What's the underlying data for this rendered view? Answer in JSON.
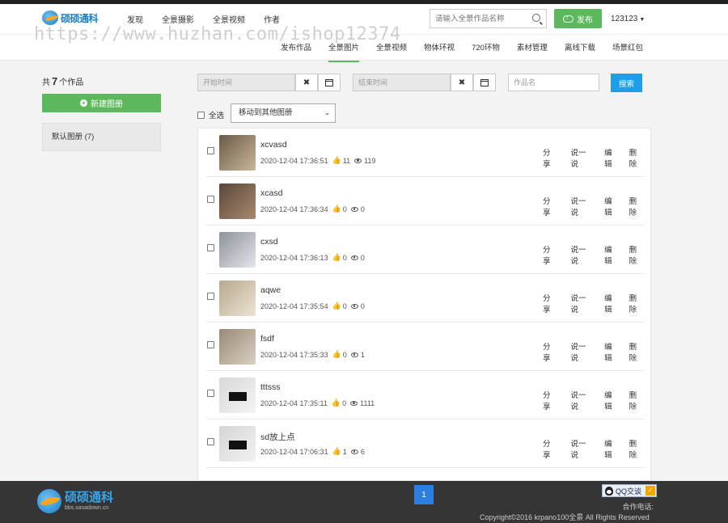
{
  "header": {
    "logo_text": "硕硕通科",
    "nav": [
      "发现",
      "全景摄影",
      "全景视频",
      "作者"
    ],
    "search_placeholder": "请输入全景作品名称",
    "publish_label": "发布",
    "username": "123123"
  },
  "watermark": "https://www.huzhan.com/ishop12374",
  "subnav": {
    "items": [
      "发布作品",
      "全景图片",
      "全景视频",
      "物体环视",
      "720环物",
      "素材管理",
      "离线下载",
      "场景红包"
    ],
    "active_index": 1
  },
  "sidebar": {
    "count_prefix": "共",
    "count": "7",
    "count_suffix": "个作品",
    "new_album_label": "新建图册",
    "album_label": "默认图册 (7)"
  },
  "filters": {
    "start_placeholder": "开始时间",
    "end_placeholder": "结束时间",
    "clear_glyph": "✖",
    "name_placeholder": "作品名",
    "search_label": "搜索",
    "select_all_label": "全选",
    "move_select_value": "移动到其他图册"
  },
  "actions": {
    "share": "分享",
    "talk": "说一说",
    "edit": "编辑",
    "delete": "删除"
  },
  "works": [
    {
      "title": "xcvasd",
      "time": "2020-12-04 17:36:51",
      "likes": "11",
      "views": "119",
      "colors": [
        "#6b5a48",
        "#c9b79a"
      ]
    },
    {
      "title": "xcasd",
      "time": "2020-12-04 17:36:34",
      "likes": "0",
      "views": "0",
      "colors": [
        "#5a4538",
        "#a88a70"
      ]
    },
    {
      "title": "cxsd",
      "time": "2020-12-04 17:36:13",
      "likes": "0",
      "views": "0",
      "colors": [
        "#8d9199",
        "#e4e6ea"
      ]
    },
    {
      "title": "aqwe",
      "time": "2020-12-04 17:35:54",
      "likes": "0",
      "views": "0",
      "colors": [
        "#b8a88e",
        "#ece4d3"
      ]
    },
    {
      "title": "fsdf",
      "time": "2020-12-04 17:35:33",
      "likes": "0",
      "views": "1",
      "colors": [
        "#9a8a75",
        "#d9d0c4"
      ]
    },
    {
      "title": "tttsss",
      "time": "2020-12-04 17:35:11",
      "likes": "0",
      "views": "1111",
      "colors": [
        "#d8d8d8",
        "#f4f4f4"
      ]
    },
    {
      "title": "sd放上点",
      "time": "2020-12-04 17:06:31",
      "likes": "1",
      "views": "6",
      "colors": [
        "#d5d5d5",
        "#f2f2f2"
      ]
    }
  ],
  "footer": {
    "logo_title": "硕硕通科",
    "logo_sub": "bbs.sasadown.cn",
    "page": "1",
    "qq_label": "QQ交谈",
    "coop_label": "合作电话:",
    "copyright": "Copyright©2016 krpano100全景 All Rights Reserved"
  },
  "colors": {
    "green": "#5cb85c",
    "blue": "#1e9ee8",
    "footer_bg": "#353535"
  }
}
